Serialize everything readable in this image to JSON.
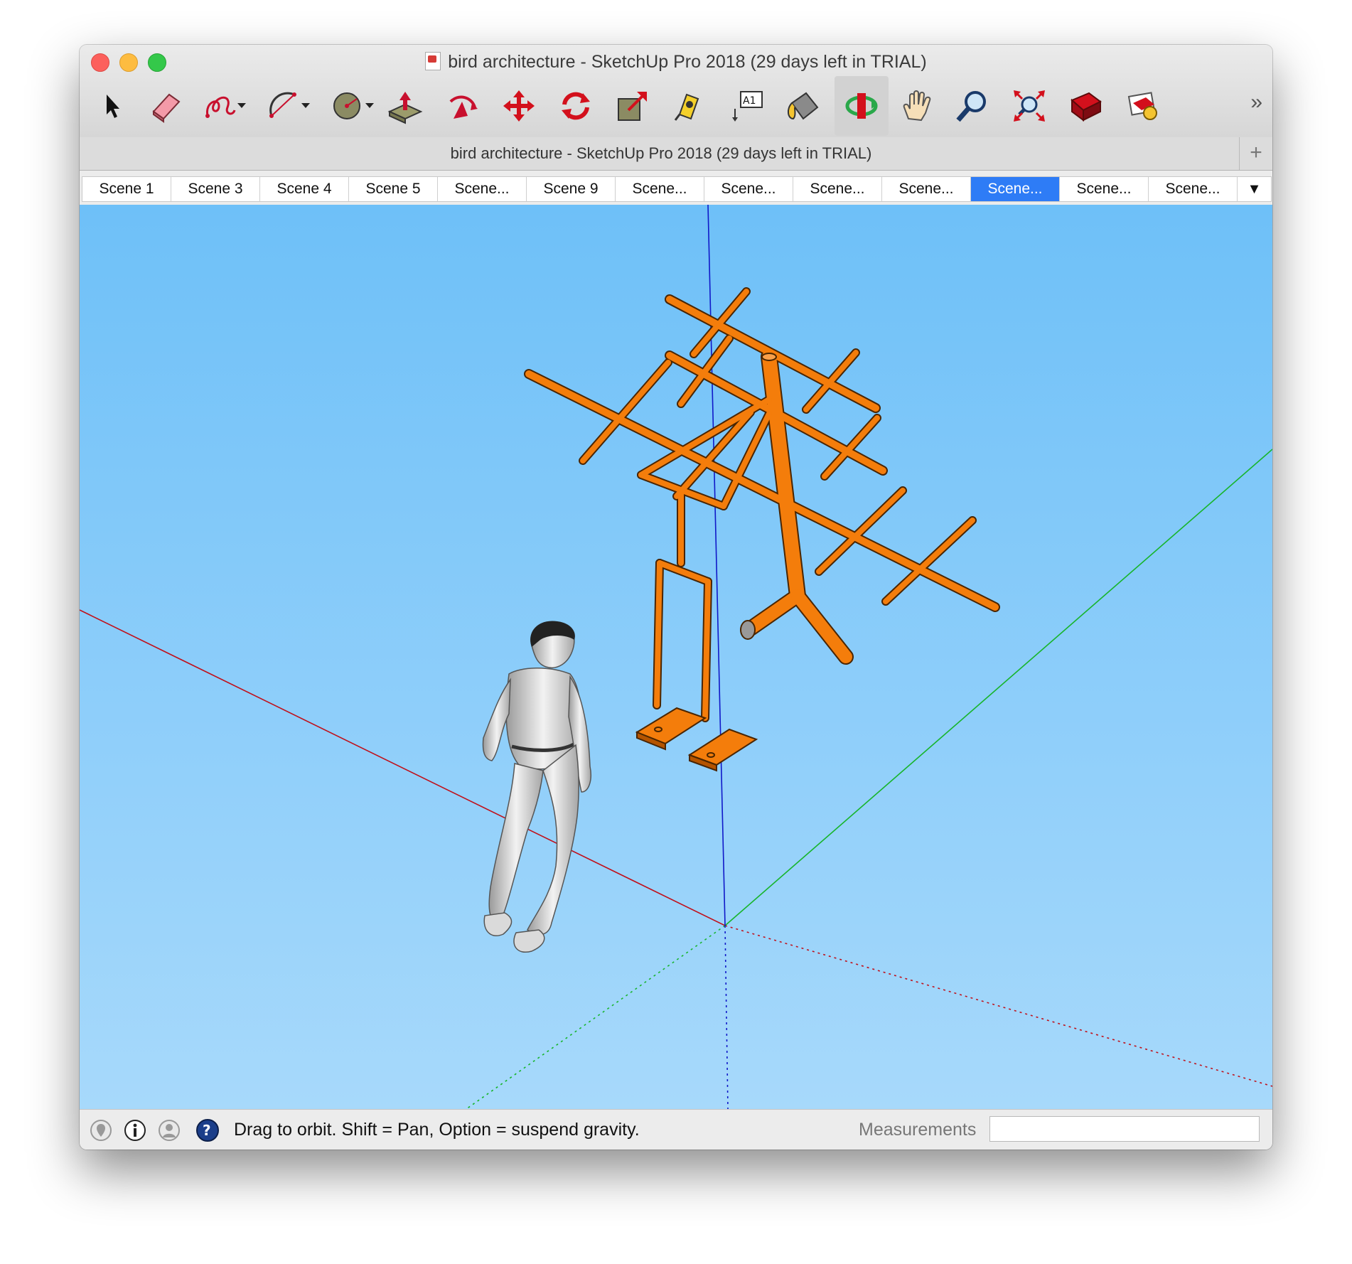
{
  "window": {
    "title": "bird architecture - SketchUp Pro 2018 (29 days left in TRIAL)"
  },
  "toolbar": {
    "tools": [
      {
        "name": "select-tool",
        "icon": "arrow-cursor-icon"
      },
      {
        "name": "eraser-tool",
        "icon": "eraser-icon"
      },
      {
        "name": "freehand-tool",
        "icon": "freehand-line-icon",
        "dropdown": true
      },
      {
        "name": "arc-tool",
        "icon": "arc-icon",
        "dropdown": true
      },
      {
        "name": "circle-tool",
        "icon": "circle-icon",
        "dropdown": true
      },
      {
        "name": "push-pull-tool",
        "icon": "push-pull-icon"
      },
      {
        "name": "follow-me-tool",
        "icon": "follow-me-icon"
      },
      {
        "name": "move-tool",
        "icon": "move-icon"
      },
      {
        "name": "rotate-tool",
        "icon": "rotate-icon"
      },
      {
        "name": "scale-tool",
        "icon": "scale-icon"
      },
      {
        "name": "tape-measure-tool",
        "icon": "tape-measure-icon"
      },
      {
        "name": "text-tool",
        "icon": "text-label-icon",
        "label": "A1"
      },
      {
        "name": "paint-bucket-tool",
        "icon": "paint-bucket-icon"
      },
      {
        "name": "orbit-tool",
        "icon": "orbit-icon",
        "active": true
      },
      {
        "name": "pan-tool",
        "icon": "hand-icon"
      },
      {
        "name": "zoom-tool",
        "icon": "magnifier-icon"
      },
      {
        "name": "zoom-extents-tool",
        "icon": "zoom-extents-icon"
      },
      {
        "name": "3d-warehouse-tool",
        "icon": "warehouse-icon"
      },
      {
        "name": "extension-warehouse-tool",
        "icon": "extension-warehouse-icon"
      }
    ],
    "overflow_label": "»"
  },
  "tabbar": {
    "title": "bird architecture - SketchUp Pro 2018 (29 days left in TRIAL)",
    "add_label": "+"
  },
  "scenes": {
    "tabs": [
      "Scene 1",
      "Scene 3",
      "Scene 4",
      "Scene 5",
      "Scene...",
      "Scene 9",
      "Scene...",
      "Scene...",
      "Scene...",
      "Scene...",
      "Scene...",
      "Scene...",
      "Scene..."
    ],
    "active_index": 10,
    "more_label": "▼"
  },
  "viewport": {
    "model_color": "#f47d0b",
    "sky_top": "#6ec0f8",
    "sky_bottom": "#a7d9fb",
    "axis_red": "#c0101a",
    "axis_green": "#17b52b",
    "axis_blue": "#1018c8"
  },
  "status": {
    "hint": "Drag to orbit. Shift = Pan, Option = suspend gravity.",
    "measurements_label": "Measurements",
    "measurements_value": ""
  }
}
